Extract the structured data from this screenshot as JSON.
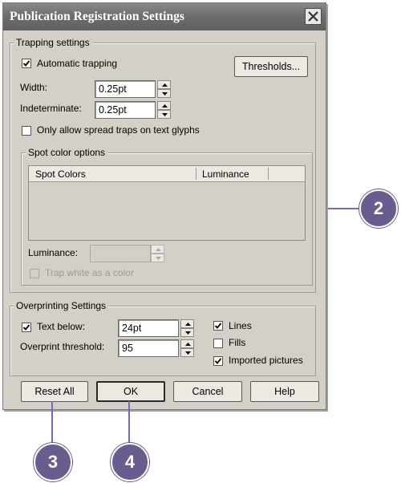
{
  "dialog": {
    "title": "Publication Registration Settings"
  },
  "trapping": {
    "legend": "Trapping settings",
    "automatic_label": "Automatic trapping",
    "automatic_checked": true,
    "thresholds_button": "Thresholds...",
    "width_label": "Width:",
    "width_value": "0.25pt",
    "indeterminate_label": "Indeterminate:",
    "indeterminate_value": "0.25pt",
    "spread_label": "Only allow spread traps on text glyphs",
    "spread_checked": false
  },
  "spot": {
    "legend": "Spot color options",
    "columns": [
      "Spot Colors",
      "Luminance"
    ],
    "rows": [],
    "luminance_label": "Luminance:",
    "luminance_value": "",
    "trap_white_label": "Trap white as a color",
    "trap_white_checked": false
  },
  "overprinting": {
    "legend": "Overprinting Settings",
    "text_below_label": "Text below:",
    "text_below_checked": true,
    "text_below_value": "24pt",
    "threshold_label": "Overprint threshold:",
    "threshold_value": "95",
    "lines_label": "Lines",
    "lines_checked": true,
    "fills_label": "Fills",
    "fills_checked": false,
    "imported_label": "Imported pictures",
    "imported_checked": true
  },
  "buttons": {
    "reset_all": "Reset All",
    "ok": "OK",
    "cancel": "Cancel",
    "help": "Help"
  },
  "callouts": {
    "two": "2",
    "three": "3",
    "four": "4"
  },
  "colors": {
    "dialog_face": "#d4d0c8",
    "callout_fill": "#6a5c8f",
    "callout_line": "#7b69b0"
  }
}
